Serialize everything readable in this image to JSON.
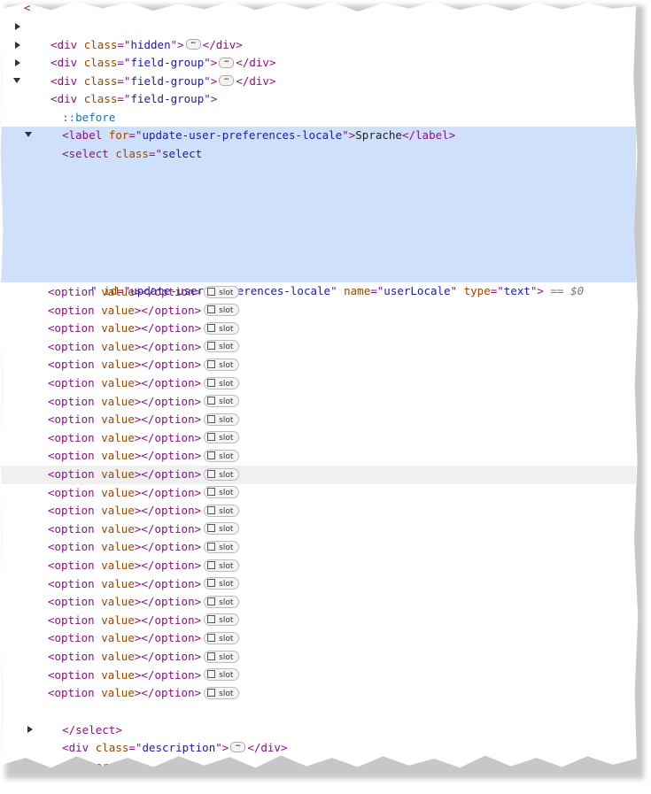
{
  "app": "Elements panel",
  "top_lines": [
    {
      "tag": "div",
      "attr": "class",
      "value": "hidden",
      "closing": "</div>"
    },
    {
      "tag": "div",
      "attr": "class",
      "value": "field-group",
      "closing": "</div>"
    },
    {
      "tag": "div",
      "attr": "class",
      "value": "field-group",
      "closing": "</div>"
    }
  ],
  "open_group": {
    "tag": "div",
    "attr": "class",
    "value": "field-group"
  },
  "pseudo_before": "::before",
  "label": {
    "attr": "for",
    "value": "update-user-preferences-locale",
    "text": "Sprache"
  },
  "select": {
    "open_text": "select",
    "class_start": "select",
    "id": "update-user-preferences-locale",
    "name": "userLocale",
    "type": "text",
    "marker": "== $0"
  },
  "options_count": 23,
  "option": {
    "text": "option",
    "attr": "value",
    "slot_label": "slot"
  },
  "close_select": "</select>",
  "description_div": {
    "tag": "div",
    "attr": "class",
    "value": "description",
    "closing": "</div>"
  },
  "pseudo_after": "::after"
}
